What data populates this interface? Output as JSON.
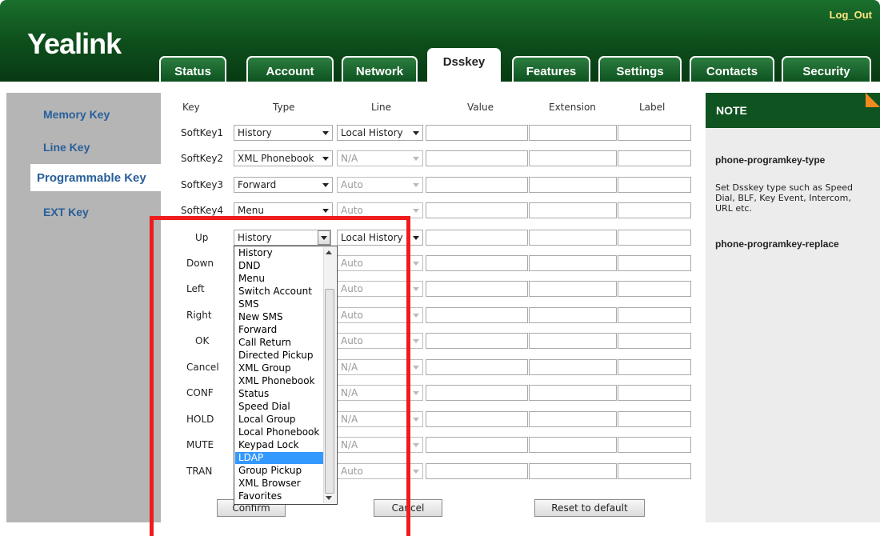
{
  "header": {
    "logo": "Yealink",
    "logout": "Log_Out"
  },
  "tabs": [
    "Status",
    "Account",
    "Network",
    "Dsskey",
    "Features",
    "Settings",
    "Contacts",
    "Security"
  ],
  "leftnav": [
    "Memory Key",
    "Line Key",
    "Programmable Key",
    "EXT Key"
  ],
  "table": {
    "headers": [
      "Key",
      "Type",
      "Line",
      "Value",
      "Extension",
      "Label"
    ],
    "rows": [
      {
        "key": "SoftKey1",
        "type": "History",
        "line": "Local History"
      },
      {
        "key": "SoftKey2",
        "type": "XML Phonebook",
        "line": "N/A"
      },
      {
        "key": "SoftKey3",
        "type": "Forward",
        "line": "Auto"
      },
      {
        "key": "SoftKey4",
        "type": "Menu",
        "line": "Auto"
      },
      {
        "key": "Up",
        "type": "History",
        "line": "Local History"
      },
      {
        "key": "Down",
        "type": "",
        "line": "Auto"
      },
      {
        "key": "Left",
        "type": "",
        "line": "Auto"
      },
      {
        "key": "Right",
        "type": "",
        "line": "Auto"
      },
      {
        "key": "OK",
        "type": "",
        "line": "Auto"
      },
      {
        "key": "Cancel",
        "type": "",
        "line": "N/A"
      },
      {
        "key": "CONF",
        "type": "",
        "line": "N/A"
      },
      {
        "key": "HOLD",
        "type": "",
        "line": "N/A"
      },
      {
        "key": "MUTE",
        "type": "",
        "line": "N/A"
      },
      {
        "key": "TRAN",
        "type": "",
        "line": "Auto"
      }
    ]
  },
  "dropdown_options": [
    "History",
    "DND",
    "Menu",
    "Switch Account",
    "SMS",
    "New SMS",
    "Forward",
    "Call Return",
    "Directed Pickup",
    "XML Group",
    "XML Phonebook",
    "Status",
    "Speed Dial",
    "Local Group",
    "Local Phonebook",
    "Keypad Lock",
    "LDAP",
    "Group Pickup",
    "XML Browser",
    "Favorites"
  ],
  "highlighted_option": "LDAP",
  "buttons": {
    "confirm": "Confirm",
    "cancel": "Cancel",
    "reset": "Reset to default"
  },
  "note": {
    "title": "NOTE",
    "item1_title": "phone-programkey-type",
    "item1_desc": "Set Dsskey type such as Speed Dial, BLF, Key Event, Intercom, URL etc.",
    "item2_title": "phone-programkey-replace"
  },
  "colors": {
    "header_green": "#0e5320",
    "nav_gray": "#b5b5b5",
    "nav_text": "#285f9a",
    "highlight": "#3399ff",
    "annotation_red": "#ee1c1c",
    "note_corner": "#f08a1e"
  }
}
